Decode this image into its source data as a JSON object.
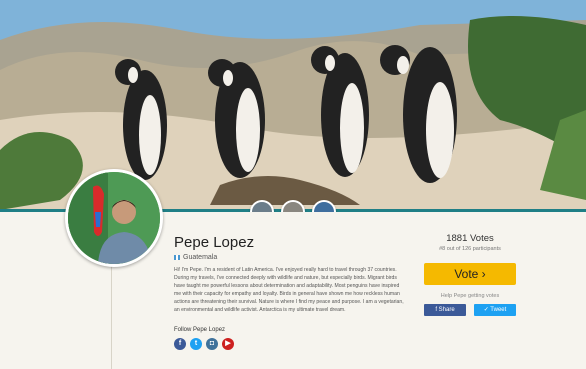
{
  "profile": {
    "name": "Pepe Lopez",
    "country": "Guatemala",
    "bio": "Hi! I'm Pepe. I'm a resident of Latin America. I've enjoyed really hard to travel through 37 countries. During my travels, I've connected deeply with wildlife and nature, but especially birds. Migrant birds have taught me powerful lessons about determination and adaptability. Most penguins have inspired me with their capacity for empathy and loyalty. Birds in general have shown me how reckless human actions are threatening their survival. Nature is where I find my peace and purpose. I am a vegetarian, an environmental and wildlife activist. Antarctica is my ultimate travel dream.",
    "follow_label": "Follow Pepe Lopez"
  },
  "vote_panel": {
    "total": "1881 Votes",
    "rank": "#8 out of 126 participants",
    "vote_label": "Vote ›",
    "help_text": "Help Pepe getting votes",
    "share_facebook": "f Share",
    "share_twitter": "Tweet"
  },
  "socials": [
    {
      "icon": "facebook-icon",
      "glyph": "f",
      "color": "#3b5998"
    },
    {
      "icon": "twitter-icon",
      "glyph": "t",
      "color": "#1da1f2"
    },
    {
      "icon": "instagram-icon",
      "glyph": "◘",
      "color": "#3f729b"
    },
    {
      "icon": "youtube-icon",
      "glyph": "▶",
      "color": "#cd201f"
    }
  ],
  "colors": {
    "accent_teal": "#1f7f86",
    "vote_yellow": "#f5b900",
    "card_bg": "#f6f4ee"
  }
}
